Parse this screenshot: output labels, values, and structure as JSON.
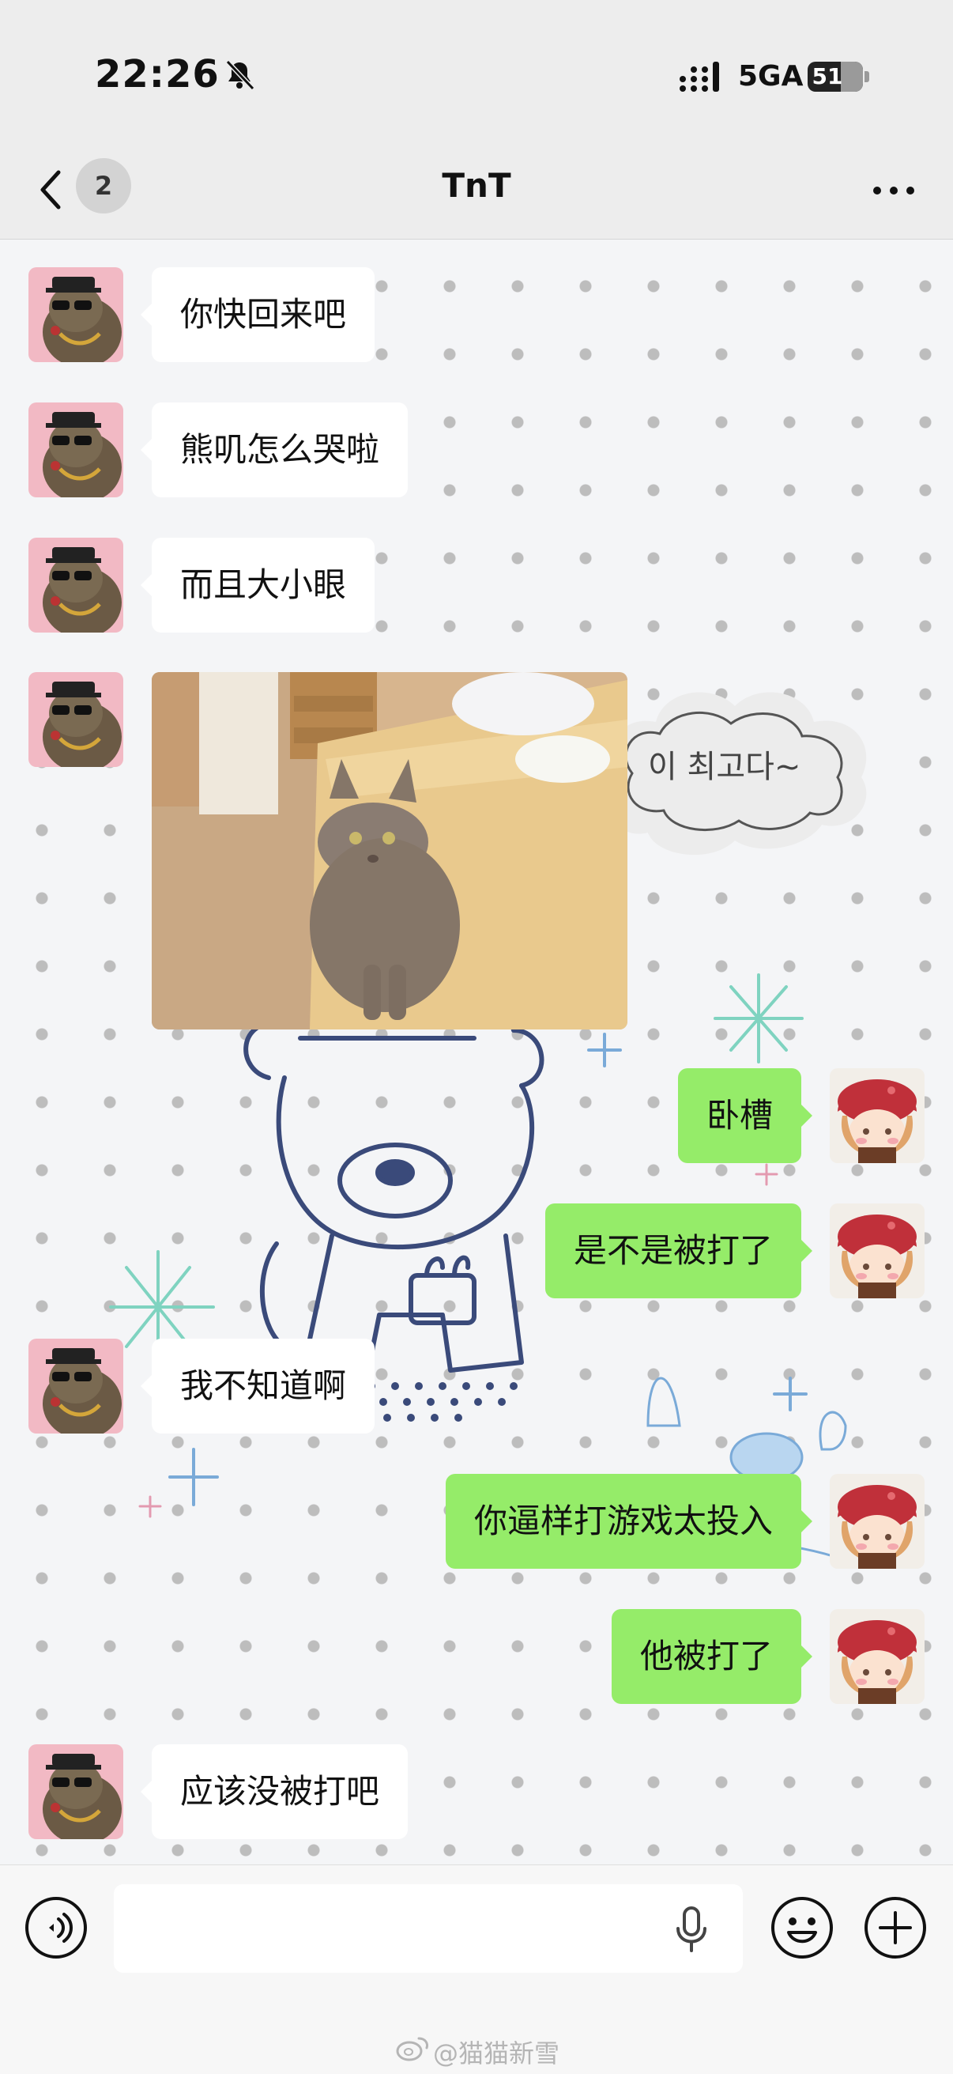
{
  "status_bar": {
    "time": "22:26",
    "network": "5GA",
    "battery": "51",
    "battery_level": 0.51
  },
  "nav": {
    "unread_count": "2",
    "title": "TnT"
  },
  "messages": [
    {
      "side": "in",
      "text": "你快回来吧"
    },
    {
      "side": "in",
      "text": "熊叽怎么哭啦"
    },
    {
      "side": "in",
      "text": "而且大小眼"
    },
    {
      "side": "in",
      "type": "image"
    },
    {
      "side": "out",
      "text": "卧槽"
    },
    {
      "side": "out",
      "text": "是不是被打了"
    },
    {
      "side": "in",
      "text": "我不知道啊"
    },
    {
      "side": "out",
      "text": "你逼样打游戏太投入"
    },
    {
      "side": "out",
      "text": "他被打了"
    },
    {
      "side": "in",
      "text": "应该没被打吧"
    }
  ],
  "wallpaper": {
    "cloud_text": "이 최고다~"
  },
  "input": {
    "value": "",
    "placeholder": ""
  },
  "watermark": {
    "text": "@猫猫新雪"
  },
  "icons": {
    "back": "chevron-left-icon",
    "more": "more-horizontal-icon",
    "voice": "voice-icon",
    "mic": "microphone-icon",
    "emoji": "emoji-icon",
    "plus": "plus-icon",
    "bell_off": "bell-off-icon",
    "signal": "signal-icon",
    "weibo": "weibo-icon"
  },
  "colors": {
    "outgoing_bubble": "#95ec69",
    "incoming_bubble": "#ffffff",
    "header_bg": "#ededed"
  }
}
